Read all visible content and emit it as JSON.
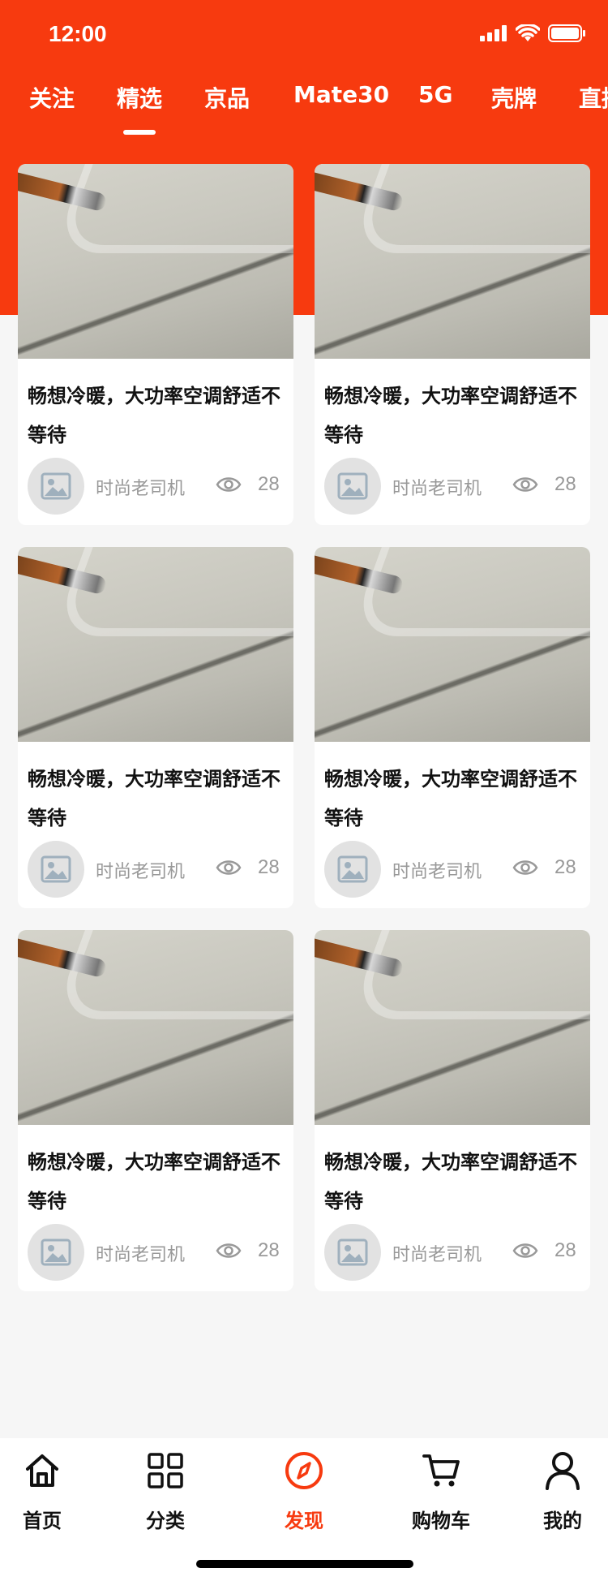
{
  "status_bar": {
    "time": "12:00"
  },
  "tabs": [
    {
      "label": "关注",
      "active": false
    },
    {
      "label": "精选",
      "active": true
    },
    {
      "label": "京品",
      "active": false
    },
    {
      "label": "Mate30",
      "active": false
    },
    {
      "label": "5G",
      "active": false
    },
    {
      "label": "壳牌",
      "active": false
    },
    {
      "label": "直播",
      "active": false
    }
  ],
  "cards": [
    {
      "title": "畅想冷暖，大功率空调舒适不等待",
      "author": "时尚老司机",
      "views": "28"
    },
    {
      "title": "畅想冷暖，大功率空调舒适不等待",
      "author": "时尚老司机",
      "views": "28"
    },
    {
      "title": "畅想冷暖，大功率空调舒适不等待",
      "author": "时尚老司机",
      "views": "28"
    },
    {
      "title": "畅想冷暖，大功率空调舒适不等待",
      "author": "时尚老司机",
      "views": "28"
    },
    {
      "title": "畅想冷暖，大功率空调舒适不等待",
      "author": "时尚老司机",
      "views": "28"
    },
    {
      "title": "畅想冷暖，大功率空调舒适不等待",
      "author": "时尚老司机",
      "views": "28"
    }
  ],
  "bottom_nav": [
    {
      "label": "首页",
      "icon": "home-icon",
      "active": false
    },
    {
      "label": "分类",
      "icon": "category-grid-icon",
      "active": false
    },
    {
      "label": "发现",
      "icon": "compass-icon",
      "active": true
    },
    {
      "label": "购物车",
      "icon": "cart-icon",
      "active": false
    },
    {
      "label": "我的",
      "icon": "user-icon",
      "active": false
    }
  ],
  "colors": {
    "brand": "#f73a0f",
    "text": "#111111",
    "muted": "#999999",
    "background": "#f6f6f6"
  }
}
